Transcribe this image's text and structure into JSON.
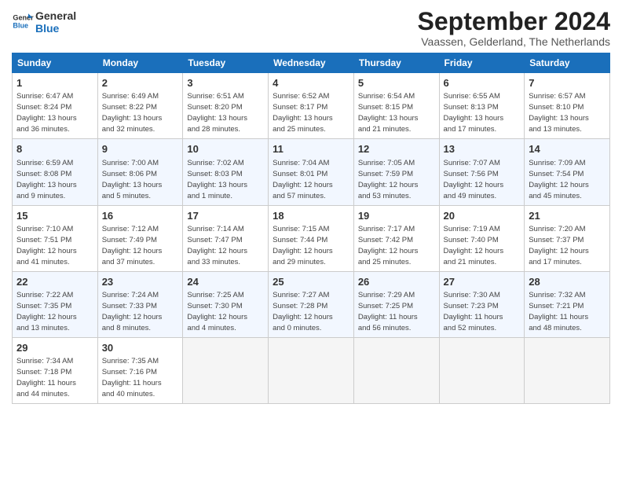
{
  "header": {
    "logo_line1": "General",
    "logo_line2": "Blue",
    "month": "September 2024",
    "location": "Vaassen, Gelderland, The Netherlands"
  },
  "days_of_week": [
    "Sunday",
    "Monday",
    "Tuesday",
    "Wednesday",
    "Thursday",
    "Friday",
    "Saturday"
  ],
  "weeks": [
    [
      {
        "day": "1",
        "info": "Sunrise: 6:47 AM\nSunset: 8:24 PM\nDaylight: 13 hours\nand 36 minutes."
      },
      {
        "day": "2",
        "info": "Sunrise: 6:49 AM\nSunset: 8:22 PM\nDaylight: 13 hours\nand 32 minutes."
      },
      {
        "day": "3",
        "info": "Sunrise: 6:51 AM\nSunset: 8:20 PM\nDaylight: 13 hours\nand 28 minutes."
      },
      {
        "day": "4",
        "info": "Sunrise: 6:52 AM\nSunset: 8:17 PM\nDaylight: 13 hours\nand 25 minutes."
      },
      {
        "day": "5",
        "info": "Sunrise: 6:54 AM\nSunset: 8:15 PM\nDaylight: 13 hours\nand 21 minutes."
      },
      {
        "day": "6",
        "info": "Sunrise: 6:55 AM\nSunset: 8:13 PM\nDaylight: 13 hours\nand 17 minutes."
      },
      {
        "day": "7",
        "info": "Sunrise: 6:57 AM\nSunset: 8:10 PM\nDaylight: 13 hours\nand 13 minutes."
      }
    ],
    [
      {
        "day": "8",
        "info": "Sunrise: 6:59 AM\nSunset: 8:08 PM\nDaylight: 13 hours\nand 9 minutes."
      },
      {
        "day": "9",
        "info": "Sunrise: 7:00 AM\nSunset: 8:06 PM\nDaylight: 13 hours\nand 5 minutes."
      },
      {
        "day": "10",
        "info": "Sunrise: 7:02 AM\nSunset: 8:03 PM\nDaylight: 13 hours\nand 1 minute."
      },
      {
        "day": "11",
        "info": "Sunrise: 7:04 AM\nSunset: 8:01 PM\nDaylight: 12 hours\nand 57 minutes."
      },
      {
        "day": "12",
        "info": "Sunrise: 7:05 AM\nSunset: 7:59 PM\nDaylight: 12 hours\nand 53 minutes."
      },
      {
        "day": "13",
        "info": "Sunrise: 7:07 AM\nSunset: 7:56 PM\nDaylight: 12 hours\nand 49 minutes."
      },
      {
        "day": "14",
        "info": "Sunrise: 7:09 AM\nSunset: 7:54 PM\nDaylight: 12 hours\nand 45 minutes."
      }
    ],
    [
      {
        "day": "15",
        "info": "Sunrise: 7:10 AM\nSunset: 7:51 PM\nDaylight: 12 hours\nand 41 minutes."
      },
      {
        "day": "16",
        "info": "Sunrise: 7:12 AM\nSunset: 7:49 PM\nDaylight: 12 hours\nand 37 minutes."
      },
      {
        "day": "17",
        "info": "Sunrise: 7:14 AM\nSunset: 7:47 PM\nDaylight: 12 hours\nand 33 minutes."
      },
      {
        "day": "18",
        "info": "Sunrise: 7:15 AM\nSunset: 7:44 PM\nDaylight: 12 hours\nand 29 minutes."
      },
      {
        "day": "19",
        "info": "Sunrise: 7:17 AM\nSunset: 7:42 PM\nDaylight: 12 hours\nand 25 minutes."
      },
      {
        "day": "20",
        "info": "Sunrise: 7:19 AM\nSunset: 7:40 PM\nDaylight: 12 hours\nand 21 minutes."
      },
      {
        "day": "21",
        "info": "Sunrise: 7:20 AM\nSunset: 7:37 PM\nDaylight: 12 hours\nand 17 minutes."
      }
    ],
    [
      {
        "day": "22",
        "info": "Sunrise: 7:22 AM\nSunset: 7:35 PM\nDaylight: 12 hours\nand 13 minutes."
      },
      {
        "day": "23",
        "info": "Sunrise: 7:24 AM\nSunset: 7:33 PM\nDaylight: 12 hours\nand 8 minutes."
      },
      {
        "day": "24",
        "info": "Sunrise: 7:25 AM\nSunset: 7:30 PM\nDaylight: 12 hours\nand 4 minutes."
      },
      {
        "day": "25",
        "info": "Sunrise: 7:27 AM\nSunset: 7:28 PM\nDaylight: 12 hours\nand 0 minutes."
      },
      {
        "day": "26",
        "info": "Sunrise: 7:29 AM\nSunset: 7:25 PM\nDaylight: 11 hours\nand 56 minutes."
      },
      {
        "day": "27",
        "info": "Sunrise: 7:30 AM\nSunset: 7:23 PM\nDaylight: 11 hours\nand 52 minutes."
      },
      {
        "day": "28",
        "info": "Sunrise: 7:32 AM\nSunset: 7:21 PM\nDaylight: 11 hours\nand 48 minutes."
      }
    ],
    [
      {
        "day": "29",
        "info": "Sunrise: 7:34 AM\nSunset: 7:18 PM\nDaylight: 11 hours\nand 44 minutes."
      },
      {
        "day": "30",
        "info": "Sunrise: 7:35 AM\nSunset: 7:16 PM\nDaylight: 11 hours\nand 40 minutes."
      },
      {
        "day": "",
        "info": ""
      },
      {
        "day": "",
        "info": ""
      },
      {
        "day": "",
        "info": ""
      },
      {
        "day": "",
        "info": ""
      },
      {
        "day": "",
        "info": ""
      }
    ]
  ]
}
